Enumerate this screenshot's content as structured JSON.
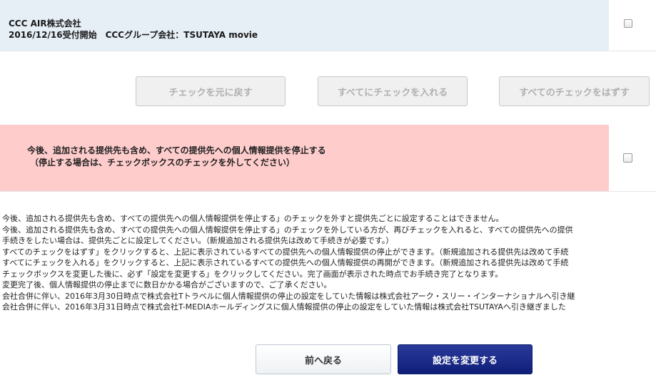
{
  "provider": {
    "name": "CCC AIR株式会社",
    "detail": "2016/12/16受付開始　CCCグループ会社：TSUTAYA movie",
    "checked": false
  },
  "bulk_buttons": {
    "restore": "チェックを元に戻す",
    "check_all": "すべてにチェックを入れる",
    "uncheck_all": "すべてのチェックをはずす"
  },
  "stop_all": {
    "line1": "今後、追加される提供先も含め、すべての提供先への個人情報提供を停止する",
    "line2": "（停止する場合は、チェックボックスのチェックを外してください）",
    "checked": false
  },
  "notes": [
    "・今後、追加される提供先も含め、すべての提供先への個人情報提供を停止する」のチェックを外すと提供先ごとに設定することはできません。",
    "・今後、追加される提供先も含め、すべての提供先への個人情報提供を停止する」のチェックを外している方が、再びチェックを入れると、すべての提供先への提供",
    "　手続きをしたい場合は、提供先ごとに設定してください。（新規追加される提供先は改めて手続きが必要です。）",
    "・すべてのチェックをはずす」をクリックすると、上記に表示されているすべての提供先への個人情報提供の停止ができます。（新規追加される提供先は改めて手続",
    "・すべてにチェックを入れる」をクリックすると、上記に表示されているすべての提供先への個人情報提供の再開ができます。（新規追加される提供先は改めて手続",
    "・チェックボックスを変更した後に、必ず「設定を変更する」をクリックしてください。完了画面が表示された時点でお手続き完了となります。",
    "・変更完了後、個人情報提供の停止までに数日かかる場合がございますので、ご了承ください。",
    "・会社合併に伴い、2016年3月30日時点で株式会社Tトラベルに個人情報提供の停止の設定をしていた情報は株式会社アーク・スリー・インターナショナルへ引き継",
    "・会社合併に伴い、2016年3月31日時点で株式会社T-MEDIAホールディングスに個人情報提供の停止の設定をしていた情報は株式会社TSUTAYAへ引き継ぎました"
  ],
  "footer": {
    "back": "前へ戻る",
    "submit": "設定を変更する"
  },
  "colors": {
    "provider_bg": "#e6eef6",
    "stop_bg": "#ffcccc",
    "submit_bg": "#1a2a8a"
  }
}
